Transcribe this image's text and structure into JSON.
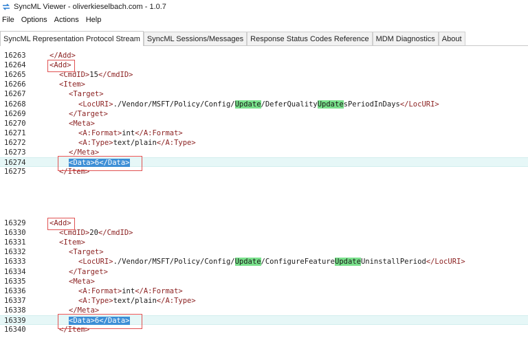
{
  "window": {
    "title": "SyncML Viewer - oliverkieselbach.com - 1.0.7"
  },
  "menu": [
    "File",
    "Options",
    "Actions",
    "Help"
  ],
  "tabs": [
    {
      "label": "SyncML Representation Protocol Stream",
      "active": true
    },
    {
      "label": "SyncML Sessions/Messages",
      "active": false
    },
    {
      "label": "Response Status Codes Reference",
      "active": false
    },
    {
      "label": "MDM Diagnostics",
      "active": false
    },
    {
      "label": "About",
      "active": false
    }
  ],
  "block1": {
    "lines": [
      {
        "n": "16263",
        "indent": 1,
        "parts": [
          [
            "tag",
            "</Add>"
          ]
        ]
      },
      {
        "n": "16264",
        "indent": 1,
        "parts": [
          [
            "tagbox",
            "<Add>"
          ]
        ]
      },
      {
        "n": "16265",
        "indent": 2,
        "parts": [
          [
            "tag",
            "<CmdID>"
          ],
          [
            "txt",
            "15"
          ],
          [
            "tag",
            "</CmdID>"
          ]
        ]
      },
      {
        "n": "16266",
        "indent": 2,
        "parts": [
          [
            "tag",
            "<Item>"
          ]
        ]
      },
      {
        "n": "16267",
        "indent": 3,
        "parts": [
          [
            "tag",
            "<Target>"
          ]
        ]
      },
      {
        "n": "16268",
        "indent": 4,
        "parts": [
          [
            "tag",
            "<LocURI>"
          ],
          [
            "txt",
            "./Vendor/MSFT/Policy/Config/"
          ],
          [
            "hw",
            "Update"
          ],
          [
            "txt",
            "/DeferQuality"
          ],
          [
            "hw",
            "Update"
          ],
          [
            "txt",
            "sPeriodInDays"
          ],
          [
            "tag",
            "</LocURI>"
          ]
        ]
      },
      {
        "n": "16269",
        "indent": 3,
        "parts": [
          [
            "tag",
            "</Target>"
          ]
        ]
      },
      {
        "n": "16270",
        "indent": 3,
        "parts": [
          [
            "tag",
            "<Meta>"
          ]
        ]
      },
      {
        "n": "16271",
        "indent": 4,
        "parts": [
          [
            "tag",
            "<A:Format>"
          ],
          [
            "txt",
            "int"
          ],
          [
            "tag",
            "</A:Format>"
          ]
        ]
      },
      {
        "n": "16272",
        "indent": 4,
        "parts": [
          [
            "tag",
            "<A:Type>"
          ],
          [
            "txt",
            "text/plain"
          ],
          [
            "tag",
            "</A:Type>"
          ]
        ]
      },
      {
        "n": "16273",
        "indent": 3,
        "parts": [
          [
            "tag",
            "</Meta>"
          ]
        ]
      },
      {
        "n": "16274",
        "indent": 3,
        "hl": true,
        "parts": [
          [
            "sel",
            "<Data>6</Data>"
          ]
        ]
      },
      {
        "n": "16275",
        "indent": 2,
        "parts": [
          [
            "tag",
            "</Item>"
          ]
        ]
      }
    ]
  },
  "block2": {
    "lines": [
      {
        "n": "16329",
        "indent": 1,
        "parts": [
          [
            "tagbox",
            "<Add>"
          ]
        ]
      },
      {
        "n": "16330",
        "indent": 2,
        "parts": [
          [
            "tag",
            "<CmdID>"
          ],
          [
            "txt",
            "20"
          ],
          [
            "tag",
            "</CmdID>"
          ]
        ]
      },
      {
        "n": "16331",
        "indent": 2,
        "parts": [
          [
            "tag",
            "<Item>"
          ]
        ]
      },
      {
        "n": "16332",
        "indent": 3,
        "parts": [
          [
            "tag",
            "<Target>"
          ]
        ]
      },
      {
        "n": "16333",
        "indent": 4,
        "parts": [
          [
            "tag",
            "<LocURI>"
          ],
          [
            "txt",
            "./Vendor/MSFT/Policy/Config/"
          ],
          [
            "hw",
            "Update"
          ],
          [
            "txt",
            "/ConfigureFeature"
          ],
          [
            "hw",
            "Update"
          ],
          [
            "txt",
            "UninstallPeriod"
          ],
          [
            "tag",
            "</LocURI>"
          ]
        ]
      },
      {
        "n": "16334",
        "indent": 3,
        "parts": [
          [
            "tag",
            "</Target>"
          ]
        ]
      },
      {
        "n": "16335",
        "indent": 3,
        "parts": [
          [
            "tag",
            "<Meta>"
          ]
        ]
      },
      {
        "n": "16336",
        "indent": 4,
        "parts": [
          [
            "tag",
            "<A:Format>"
          ],
          [
            "txt",
            "int"
          ],
          [
            "tag",
            "</A:Format>"
          ]
        ]
      },
      {
        "n": "16337",
        "indent": 4,
        "parts": [
          [
            "tag",
            "<A:Type>"
          ],
          [
            "txt",
            "text/plain"
          ],
          [
            "tag",
            "</A:Type>"
          ]
        ]
      },
      {
        "n": "16338",
        "indent": 3,
        "parts": [
          [
            "tag",
            "</Meta>"
          ]
        ]
      },
      {
        "n": "16339",
        "indent": 3,
        "hl": true,
        "parts": [
          [
            "sel",
            "<Data>6</Data>"
          ]
        ]
      },
      {
        "n": "16340",
        "indent": 2,
        "parts": [
          [
            "tag",
            "</Item>"
          ]
        ]
      }
    ]
  },
  "colors": {
    "tag": "#8a1f1f",
    "highlight_word": "#79e08b",
    "selection": "#3d8fd6",
    "annotation_box": "#e05050",
    "current_line": "#e6f7f7"
  }
}
